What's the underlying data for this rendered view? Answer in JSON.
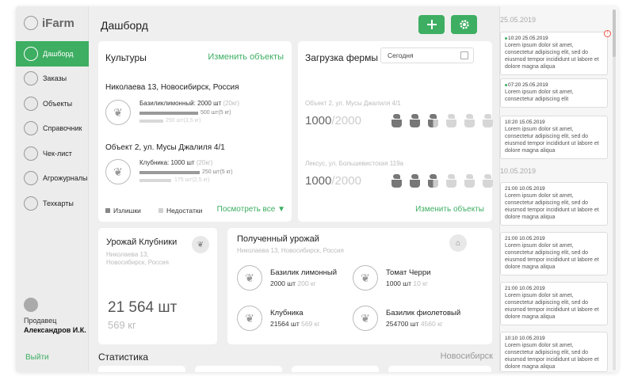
{
  "app": {
    "name": "iFarm"
  },
  "sidebar": {
    "items": [
      {
        "label": "Дашборд"
      },
      {
        "label": "Заказы"
      },
      {
        "label": "Объекты"
      },
      {
        "label": "Справочник"
      },
      {
        "label": "Чек-лист"
      },
      {
        "label": "Агрожурналы"
      },
      {
        "label": "Техкарты"
      }
    ],
    "active_index": 0,
    "seller_role": "Продавец",
    "seller_name": "Александров И.К.",
    "logout": "Выйти"
  },
  "header": {
    "title": "Дашборд",
    "add_icon": "plus-icon",
    "settings_icon": "gear-icon"
  },
  "crops": {
    "title": "Культуры",
    "edit_link": "Изменить объекты",
    "objects": [
      {
        "address": "Николаева 13, Новосибирск, Россия",
        "product_name": "Базиликлимонный:",
        "product_amount": "2000 шт",
        "product_weight": "(20кг)",
        "surplus_value": "500 шт(5 кг)",
        "shortage_value": "250 шт(3,5 кг)"
      },
      {
        "address": "Объект 2,  ул. Мусы Джалиля 4/1",
        "product_name": "Клубника:",
        "product_amount": "1000 шт",
        "product_weight": "(20кг)",
        "surplus_value": "250 шт(5 кг)",
        "shortage_value": "175 шт(2,5 кг)"
      }
    ],
    "legend_surplus": "Излишки",
    "legend_shortage": "Недостатки",
    "see_all": "Посмотреть все ▼"
  },
  "farm_load": {
    "title": "Загрузка фермы",
    "date_value": "Сегодня",
    "farms": [
      {
        "address": "Объект 2,  ул. Мусы Джалиля 4/1",
        "used": "1000",
        "total": "/2000",
        "pots": [
          "full",
          "full",
          "half",
          "empty",
          "empty",
          "empty"
        ]
      },
      {
        "address": "Лексус,  ул. Большевистская 119а",
        "used": "1000",
        "total": "/2000",
        "pots": [
          "full",
          "full",
          "half",
          "empty",
          "empty",
          "empty"
        ]
      }
    ],
    "edit_link": "Изменить объекты"
  },
  "strawberry": {
    "title": "Урожай Клубники",
    "address_line1": "Николаева 13,",
    "address_line2": "Новосибирск, Россия",
    "count": "21 564 шт",
    "weight": "569 кг"
  },
  "harvest": {
    "title": "Полученный урожай",
    "address": "Николаева 13, Новосибирск, Россия",
    "items": [
      {
        "name": "Базилик лимонный",
        "qty": "2000 шт",
        "weight": "200 кг"
      },
      {
        "name": "Томат Черри",
        "qty": "1000 шт",
        "weight": "10 кг"
      },
      {
        "name": "Клубника",
        "qty": "21564 шт",
        "weight": "569 кг"
      },
      {
        "name": "Базилик фиолетовый",
        "qty": "254700 шт",
        "weight": "4560 кг"
      }
    ]
  },
  "stats": {
    "title": "Статистика",
    "city": "Новосибирск"
  },
  "feed": {
    "groups": [
      {
        "date": "25.05.2019",
        "notes": [
          {
            "time": "10:20 25.05.2019",
            "text": "Lorem ipsum dolor sit amet, consectetur adipiscing elit, sed do eiusmod tempor incididunt ut labore et dolore magna aliqua",
            "unread": true,
            "alert": true
          },
          {
            "time": "07:20 25.05.2019",
            "text": "Lorem ipsum dolor sit amet, consectetur adipiscing elit",
            "unread": true,
            "alert": false
          },
          {
            "time": "10:20 15.05.2019",
            "text": "Lorem ipsum dolor sit amet, consectetur adipiscing elit, sed do eiusmod tempor incididunt ut labore et dolore magna aliqua",
            "unread": false,
            "alert": false
          }
        ]
      },
      {
        "date": "10.05.2019",
        "notes": [
          {
            "time": "21:00 10.05.2019",
            "text": "Lorem ipsum dolor sit amet, consectetur adipiscing elit, sed do eiusmod tempor incididunt ut labore et dolore magna aliqua",
            "unread": false,
            "alert": false
          },
          {
            "time": "21:00 10.05.2019",
            "text": "Lorem ipsum dolor sit amet, consectetur adipiscing elit, sed do eiusmod tempor incididunt ut labore et dolore magna aliqua",
            "unread": false,
            "alert": false
          },
          {
            "time": "21:00 10.05.2019",
            "text": "Lorem ipsum dolor sit amet, consectetur adipiscing elit, sed do eiusmod tempor incididunt ut labore et dolore magna aliqua",
            "unread": false,
            "alert": false
          },
          {
            "time": "10:10 10.05.2019",
            "text": "Lorem ipsum dolor sit amet, consectetur adipiscing elit, sed do eiusmod tempor incididunt ut labore et dolore magna aliqua",
            "unread": false,
            "alert": false
          }
        ]
      }
    ]
  },
  "colors": {
    "accent": "#3dae62"
  }
}
